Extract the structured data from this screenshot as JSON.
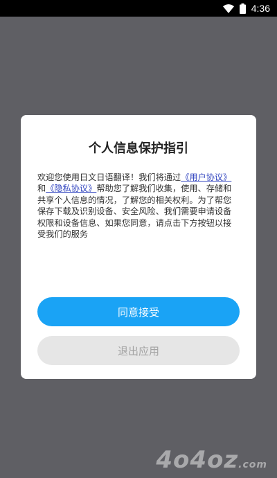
{
  "status_bar": {
    "time": "4:36",
    "wifi_icon": "wifi-icon",
    "battery_icon": "battery-icon"
  },
  "dialog": {
    "title": "个人信息保护指引",
    "body": {
      "intro": "欢迎您使用日文日语翻译！我们将通过",
      "user_agreement": "《用户协议》",
      "and": "和",
      "privacy_policy": "《隐私协议》",
      "rest": "帮助您了解我们收集，使用、存储和共享个人信息的情况，了解您的相关权利。为了帮您保存下载及识别设备、安全风险、我们需要申请设备权限和设备信息、如果您同意，请点击下方按钮以接受我们的服务"
    },
    "accept_label": "同意接受",
    "exit_label": "退出应用"
  },
  "watermark": {
    "text": "4o4oz",
    "suffix": ".com"
  },
  "colors": {
    "overlay": "#5f5f64",
    "accent": "#1aa3f5",
    "link": "#3346c0",
    "secondary_button": "#e6e6e6"
  }
}
